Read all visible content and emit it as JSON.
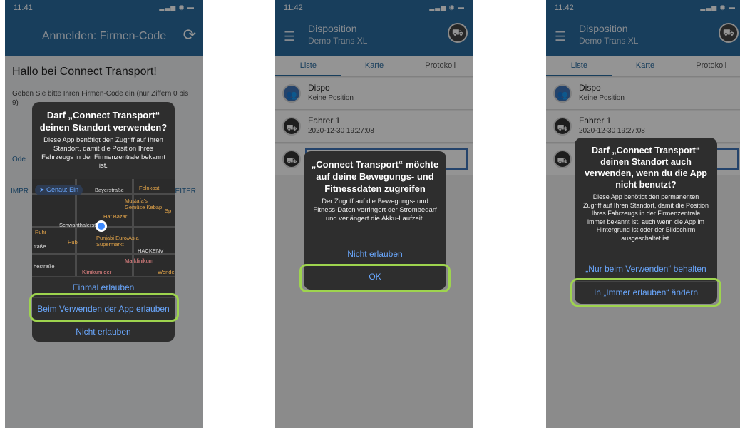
{
  "phone1": {
    "time": "11:41",
    "status_icons": "▂▃▅ ◉ ▬",
    "appbar_title": "Anmelden: Firmen-Code",
    "refresh_icon": "refresh-icon",
    "greeting": "Hallo bei Connect Transport!",
    "instruction": "Geben Sie bitte Ihren Firmen-Code ein (nur Ziffern 0 bis 9)",
    "bottom_left_link": "Ode",
    "imprint": "IMPR",
    "next": "EITER",
    "alert": {
      "title": "Darf „Connect Transport“ deinen Standort verwenden?",
      "body": "Diese App benötigt den Zugriff auf Ihren Standort, damit die Position Ihres Fahrzeugs in der Firmenzentrale bekannt ist.",
      "map": {
        "badge": "Genau: Ein",
        "streets": [
          "Bayerstraße",
          "Schwanthalerstr.",
          "traße",
          "hestraße",
          "HACKENV"
        ],
        "places": [
          "Felnkost",
          "Mustafa's Gemüse Kebap",
          "Hat Bazar",
          "Ruhi",
          "Hubi",
          "Punjabi Euro/Asia Supermarkt",
          "Marklinikum",
          "Klinikum der",
          "Wonde",
          "Sp"
        ]
      },
      "buttons": {
        "once": "Einmal erlauben",
        "while_using": "Beim Verwenden der App erlauben",
        "deny": "Nicht erlauben"
      }
    }
  },
  "phone2": {
    "time": "11:42",
    "status_icons": "▂▃▅ ◉ ▬",
    "menu_icon": "menu-icon",
    "title": "Disposition",
    "subtitle": "Demo Trans XL",
    "tabs": [
      "Liste",
      "Karte",
      "Protokoll"
    ],
    "rows": [
      {
        "name": "Dispo",
        "detail": "Keine Position"
      },
      {
        "name": "Fahrer 1",
        "detail": "2020-12-30 19:27:08"
      }
    ],
    "alert": {
      "title": "„Connect Transport“ möchte auf deine Bewegungs- und Fitnessdaten zugreifen",
      "body": "Der Zugriff auf die Bewegungs- und Fitness-Daten verringert der Strombedarf und verlängert die Akku-Laufzeit.",
      "deny": "Nicht erlauben",
      "ok": "OK"
    }
  },
  "phone3": {
    "time": "11:42",
    "status_icons": "▂▃▅ ◉ ▬",
    "title": "Disposition",
    "subtitle": "Demo Trans XL",
    "tabs": [
      "Liste",
      "Karte",
      "Protokoll"
    ],
    "rows": [
      {
        "name": "Dispo",
        "detail": "Keine Position"
      },
      {
        "name": "Fahrer 1",
        "detail": "2020-12-30 19:27:08"
      }
    ],
    "alert": {
      "title": "Darf „Connect Transport“ deinen Standort auch verwenden, wenn du die App nicht benutzt?",
      "body": "Diese App benötigt den permanenten Zugriff auf Ihren Standort, damit die Position Ihres Fahrzeugs in der Firmenzentrale immer bekannt ist, auch wenn die App im Hintergrund ist oder der Bildschirm ausgeschaltet ist.",
      "keep": "„Nur beim Verwenden“ behalten",
      "change": "In „Immer erlauben“ ändern"
    }
  },
  "colors": {
    "appbar": "#2a6b9f",
    "alert_bg": "#2e2e2e",
    "link_blue": "#6aa8ff",
    "highlight": "#9ed44e"
  }
}
